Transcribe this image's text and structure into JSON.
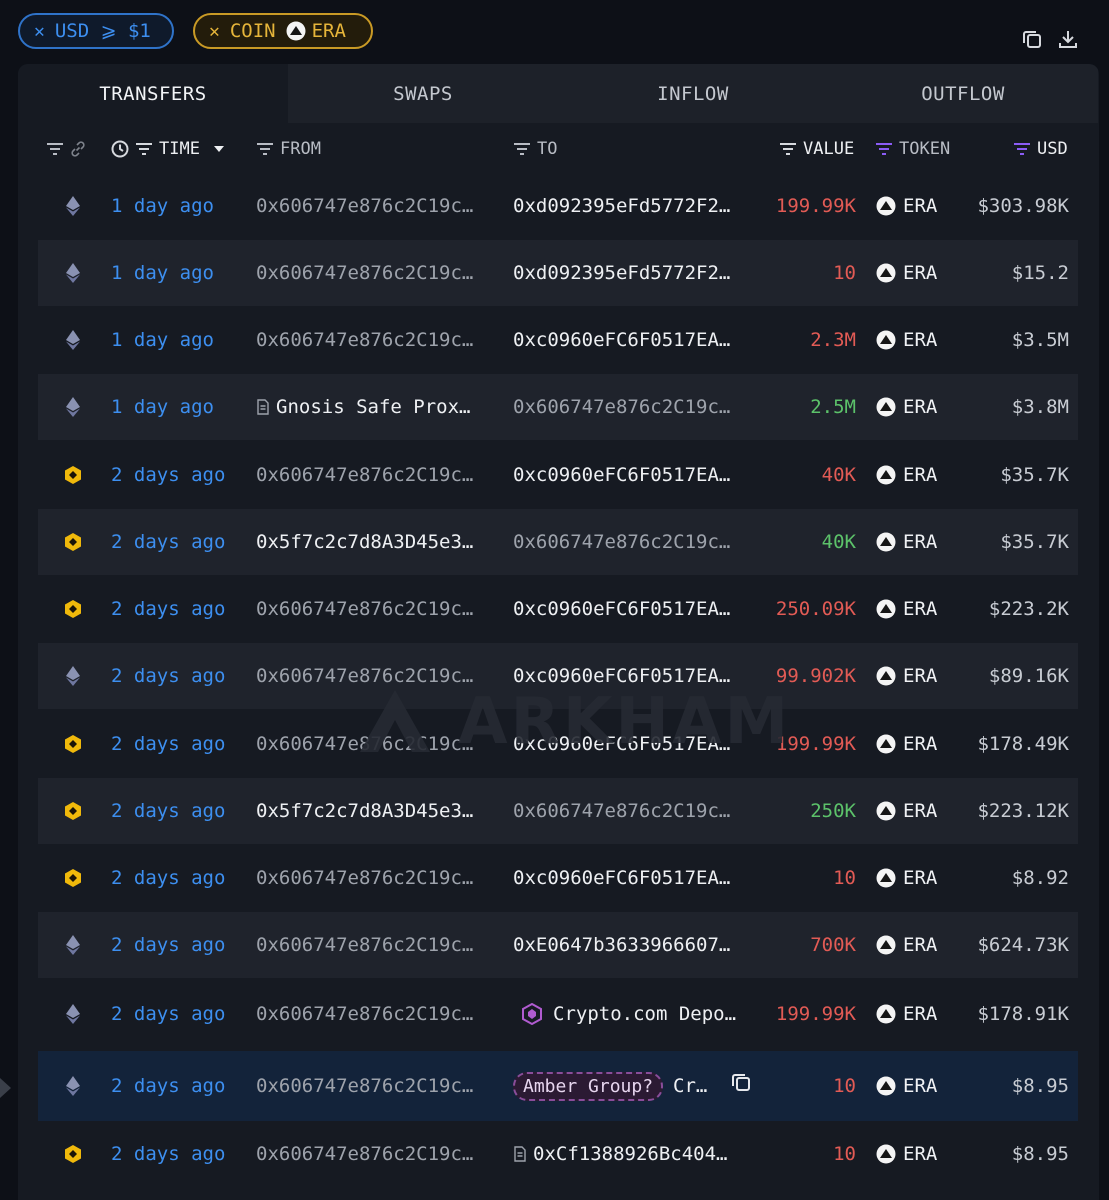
{
  "filters": [
    {
      "id": "usd",
      "remove": "✕",
      "label": "USD ⩾ $1"
    },
    {
      "id": "coin",
      "remove": "✕",
      "label": "COIN",
      "token": "ERA"
    }
  ],
  "toolbar": {
    "copy_icon": "copy-icon",
    "download_icon": "download-icon"
  },
  "tabs": [
    {
      "label": "TRANSFERS",
      "active": true
    },
    {
      "label": "SWAPS",
      "active": false
    },
    {
      "label": "INFLOW",
      "active": false
    },
    {
      "label": "OUTFLOW",
      "active": false
    }
  ],
  "columns": {
    "time": "TIME",
    "from": "FROM",
    "to": "TO",
    "value": "VALUE",
    "token": "TOKEN",
    "usd": "USD"
  },
  "watermark": "ARKHAM",
  "colors": {
    "link": "#3d8ff0",
    "negative": "#e25b55",
    "positive": "#5cc26a",
    "eth": "#8a92b2",
    "bnb": "#f0b90b",
    "filter_icon": "#8b5cf6"
  },
  "rows": [
    {
      "chain": "eth",
      "time": "1 day ago",
      "from": "0x606747e876c2C19c…",
      "from_style": "dim",
      "to": "0xd092395eFd5772F2…",
      "to_style": "bright",
      "value": "199.99K",
      "dir": "neg",
      "token": "ERA",
      "usd": "$303.98K"
    },
    {
      "chain": "eth",
      "time": "1 day ago",
      "from": "0x606747e876c2C19c…",
      "from_style": "dim",
      "to": "0xd092395eFd5772F2…",
      "to_style": "bright",
      "value": "10",
      "dir": "neg",
      "token": "ERA",
      "usd": "$15.2"
    },
    {
      "chain": "eth",
      "time": "1 day ago",
      "from": "0x606747e876c2C19c…",
      "from_style": "dim",
      "to": "0xc0960eFC6F0517EA…",
      "to_style": "bright",
      "value": "2.3M",
      "dir": "neg",
      "token": "ERA",
      "usd": "$3.5M"
    },
    {
      "chain": "eth",
      "time": "1 day ago",
      "from": "Gnosis Safe Prox…",
      "from_style": "bright",
      "from_contract": true,
      "to": "0x606747e876c2C19c…",
      "to_style": "dim",
      "value": "2.5M",
      "dir": "pos",
      "token": "ERA",
      "usd": "$3.8M"
    },
    {
      "chain": "bnb",
      "time": "2 days ago",
      "from": "0x606747e876c2C19c…",
      "from_style": "dim",
      "to": "0xc0960eFC6F0517EA…",
      "to_style": "bright",
      "value": "40K",
      "dir": "neg",
      "token": "ERA",
      "usd": "$35.7K"
    },
    {
      "chain": "bnb",
      "time": "2 days ago",
      "from": "0x5f7c2c7d8A3D45e3…",
      "from_style": "bright",
      "to": "0x606747e876c2C19c…",
      "to_style": "dim",
      "value": "40K",
      "dir": "pos",
      "token": "ERA",
      "usd": "$35.7K"
    },
    {
      "chain": "bnb",
      "time": "2 days ago",
      "from": "0x606747e876c2C19c…",
      "from_style": "dim",
      "to": "0xc0960eFC6F0517EA…",
      "to_style": "bright",
      "value": "250.09K",
      "dir": "neg",
      "token": "ERA",
      "usd": "$223.2K"
    },
    {
      "chain": "eth",
      "time": "2 days ago",
      "from": "0x606747e876c2C19c…",
      "from_style": "dim",
      "to": "0xc0960eFC6F0517EA…",
      "to_style": "bright",
      "value": "99.902K",
      "dir": "neg",
      "token": "ERA",
      "usd": "$89.16K"
    },
    {
      "chain": "bnb",
      "time": "2 days ago",
      "from": "0x606747e876c2C19c…",
      "from_style": "dim",
      "to": "0xc0960eFC6F0517EA…",
      "to_style": "bright",
      "value": "199.99K",
      "dir": "neg",
      "token": "ERA",
      "usd": "$178.49K"
    },
    {
      "chain": "bnb",
      "time": "2 days ago",
      "from": "0x5f7c2c7d8A3D45e3…",
      "from_style": "bright",
      "to": "0x606747e876c2C19c…",
      "to_style": "dim",
      "value": "250K",
      "dir": "pos",
      "token": "ERA",
      "usd": "$223.12K"
    },
    {
      "chain": "bnb",
      "time": "2 days ago",
      "from": "0x606747e876c2C19c…",
      "from_style": "dim",
      "to": "0xc0960eFC6F0517EA…",
      "to_style": "bright",
      "value": "10",
      "dir": "neg",
      "token": "ERA",
      "usd": "$8.92"
    },
    {
      "chain": "eth",
      "time": "2 days ago",
      "from": "0x606747e876c2C19c…",
      "from_style": "dim",
      "to": "0xE0647b3633966607…",
      "to_style": "bright",
      "value": "700K",
      "dir": "neg",
      "token": "ERA",
      "usd": "$624.73K"
    },
    {
      "chain": "eth",
      "time": "2 days ago",
      "from": "0x606747e876c2C19c…",
      "from_style": "dim",
      "to": "Crypto.com Depo…",
      "to_style": "bright",
      "to_entity": "cryptocom",
      "value": "199.99K",
      "dir": "neg",
      "token": "ERA",
      "usd": "$178.91K"
    },
    {
      "chain": "eth",
      "time": "2 days ago",
      "from": "0x606747e876c2C19c…",
      "from_style": "dim",
      "to_pill": "Amber Group?",
      "to": "Cr…",
      "to_style": "bright",
      "copy": true,
      "highlight": true,
      "value": "10",
      "dir": "neg",
      "token": "ERA",
      "usd": "$8.95"
    },
    {
      "chain": "bnb",
      "time": "2 days ago",
      "from": "0x606747e876c2C19c…",
      "from_style": "dim",
      "to": "0xCf1388926Bc404…",
      "to_style": "bright",
      "to_contract": true,
      "value": "10",
      "dir": "neg",
      "token": "ERA",
      "usd": "$8.95"
    }
  ]
}
